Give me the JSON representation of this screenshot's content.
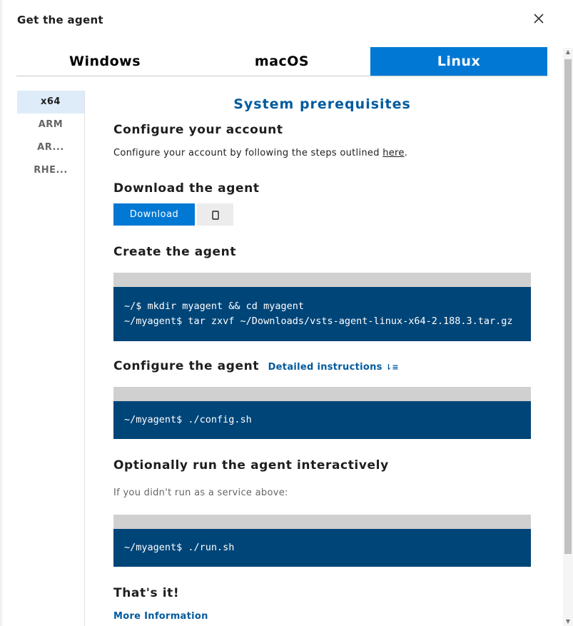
{
  "dialog": {
    "title": "Get the agent",
    "close_icon": "close-icon"
  },
  "tabs": [
    {
      "label": "Windows",
      "active": false
    },
    {
      "label": "macOS",
      "active": false
    },
    {
      "label": "Linux",
      "active": true
    }
  ],
  "architectures": [
    {
      "label": "x64",
      "active": true
    },
    {
      "label": "ARM",
      "active": false
    },
    {
      "label": "AR...",
      "active": false
    },
    {
      "label": "RHE...",
      "active": false
    }
  ],
  "content": {
    "heading": "System prerequisites",
    "configure_account": {
      "title": "Configure your account",
      "text": "Configure your account by following the steps outlined ",
      "link": "here",
      "suffix": "."
    },
    "download": {
      "title": "Download the agent",
      "button_label": "Download",
      "copy_icon": "clipboard-icon"
    },
    "create": {
      "title": "Create the agent",
      "code_lines": [
        "~/$ mkdir myagent && cd myagent",
        "~/myagent$ tar zxvf ~/Downloads/vsts-agent-linux-x64-2.188.3.tar.gz"
      ]
    },
    "configure": {
      "title": "Configure the agent",
      "link": "Detailed instructions",
      "link_icon": "expand-instructions-icon",
      "code": "~/myagent$ ./config.sh"
    },
    "run": {
      "title": "Optionally run the agent interactively",
      "note": "If you didn't run as a service above:",
      "code": "~/myagent$ ./run.sh"
    },
    "done": {
      "title": "That's it!",
      "link": "More Information"
    }
  },
  "colors": {
    "accent": "#0078d4",
    "code_bg": "#004578",
    "heading": "#005a9e"
  }
}
